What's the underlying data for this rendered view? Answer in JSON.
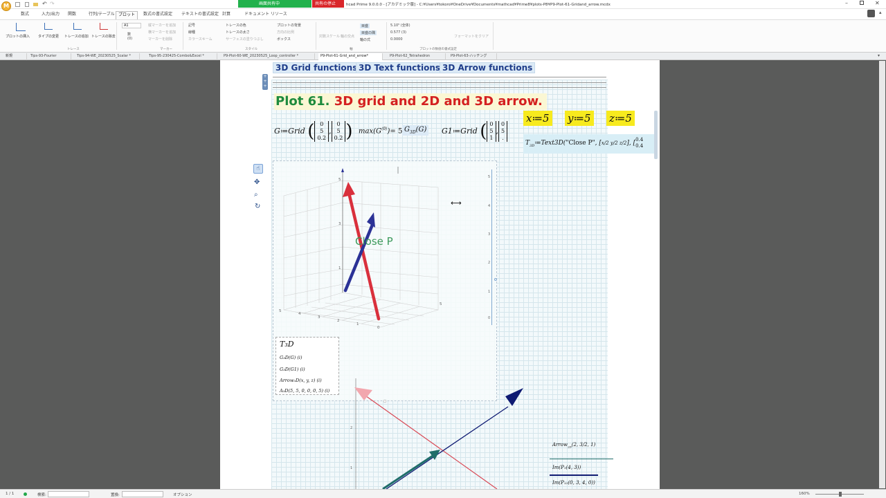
{
  "titlebar": {
    "app_title": "hcad Prime 9.0.0.0 - [アカデミック版] - C:¥Users¥tokoro¥OneDrive¥Documents¥mathcad¥Prime8¥plots-P8¥P9-Plot-61-Gridand_arrow.mcdx",
    "recording_label": "画面共有中",
    "stop_label": "共有の停止"
  },
  "ribbon_tabs": [
    "数式",
    "入力/出力",
    "関数",
    "行列/テーブル",
    "プロット",
    "数式の書式設定",
    "テキストの書式設定",
    "計算",
    "ドキュメント",
    "リソース"
  ],
  "ribbon": {
    "insert_plot": "プロットの挿入",
    "change_type": "タイプの変更",
    "add_trace": "トレースの追加",
    "remove_trace": "トレースの除去",
    "trace_group": "トレース",
    "marker_items": [
      "縦マーカーを追加",
      "横マーカーを追加",
      "マーカーを削除"
    ],
    "marker_group": "マーカー",
    "axis_value": "A1",
    "count_label": "数",
    "count_value": "(0)",
    "style_items": [
      "記号",
      "トレースの色",
      "線種",
      "トレースの太さ",
      "カラースキーム",
      "サーフェスの塗りつぶし"
    ],
    "style_group": "スタイル",
    "bg_items": [
      "プロットの背景",
      "方向の比例",
      "ボックス"
    ],
    "axis_items": [
      "対数スケール",
      "軸の交点",
      "目盛",
      "目盛の隅",
      "軸の式"
    ],
    "axis_group": "軸",
    "format_items": [
      "5.10⁵ (全体)",
      "0.577 (3)",
      "0.0000"
    ],
    "format_group": "プロットの数値の書式設定",
    "format_clear": "フォーマットをクリア"
  },
  "doc_tabs": [
    {
      "label": "新規",
      "active": false
    },
    {
      "label": "Tips-93-Fourier",
      "active": false
    },
    {
      "label": "Tips-94-WE_20230525_Scalar *",
      "active": false
    },
    {
      "label": "Tips-95-230425-Combo&Excel *",
      "active": false
    },
    {
      "label": "P9-Plot-60-WE_20230525_Loop_controller *",
      "active": false
    },
    {
      "label": "P9-Plot-61-Grid_and_arrow*",
      "active": true
    },
    {
      "label": "P9-Plot-62_Tetrahedron",
      "active": false
    },
    {
      "label": "P9-Plot-63-ハッチング",
      "active": false
    }
  ],
  "doc": {
    "links": [
      "3D Grid functions",
      "3D Text functions",
      "3D Arrow functions"
    ],
    "heading_num": "Plot 61.",
    "heading_text": "3D grid and 2D and 3D arrow.",
    "eq_g": "G≔Grid",
    "eq_max": "max",
    "eq_max_result": "= 5",
    "eq_g3d": "G",
    "eq_g1": "G1≔Grid",
    "var_x": "x≔5",
    "var_y": "y≔5",
    "var_z": "z≔5",
    "text3d": "T",
    "text3d_def": "≔Text3D",
    "text3d_str": "\"Close P\"",
    "text3d_vals": [
      "0.4",
      "0.4"
    ],
    "plot_label": "Close P",
    "plot_xyz_ticks": [
      "0",
      "1",
      "2",
      "3",
      "4",
      "5"
    ],
    "side_axis_ticks": [
      "5",
      "4",
      "3",
      "2",
      "1",
      "0"
    ],
    "legend_items": [
      "T₃D",
      "G₃D(G)  (i)",
      "G₃D(G1)  (i)",
      "Arrow₃D(x, y, z)  (i)",
      "A₃D(5, 5, 0, 0, 0, 5)  (i)"
    ],
    "arrow2d_label": "Arrow",
    "arrow2d_args": "(2, 3/2, 1)",
    "im1": "Im(P₁(4, 3))",
    "im2": "Im(P₁₃(0, 3, 4, 0))",
    "plot2d_ticks": [
      "2",
      "1"
    ]
  },
  "colors": {
    "arrow_red": "#d9303c",
    "arrow_blue": "#2b3296",
    "arrow_pink": "#f2a7ae",
    "arrow_navy": "#0e1a72",
    "arrow_teal": "#1f6d6a",
    "heading_green": "#1d8a3c",
    "heading_red": "#d42020"
  },
  "status": {
    "page": "1 / 1",
    "search_label": "検索:",
    "replace_label": "置換:",
    "options_label": "オプション",
    "zoom": "160%"
  }
}
